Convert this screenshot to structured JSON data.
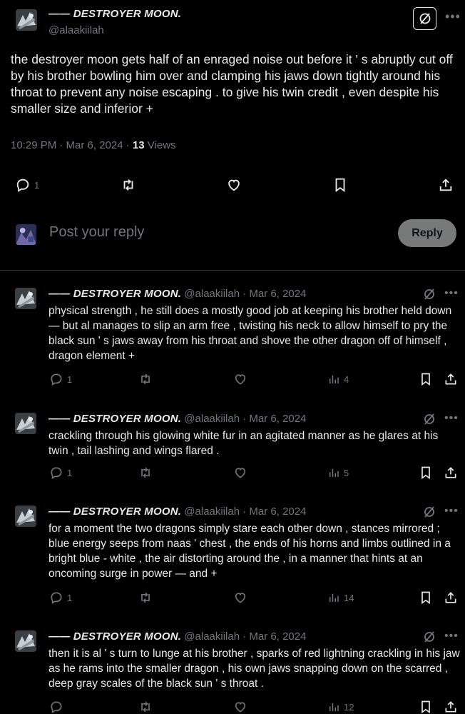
{
  "main_tweet": {
    "display_name": "—— DESTROYER MOON.",
    "handle": "@alaakiilah",
    "text": "the destroyer moon gets half of an enraged noise out before it ' s abruptly cut off by his brother bowling him over and clamping his jaws down tightly around his throat to prevent any noise escaping . to give his twin credit , even despite his smaller size and inferior +",
    "time": "10:29 PM · Mar 6, 2024 ·",
    "views_count": "13",
    "views_label": "Views",
    "reply_count": "1"
  },
  "reply_box": {
    "placeholder": "Post your reply",
    "button_label": "Reply"
  },
  "thread": [
    {
      "display_name": "—— DESTROYER MOON.",
      "handle_date": "@alaakiilah · Mar 6, 2024",
      "text": "physical strength , he still does a mostly good job at keeping his brother held down — but al manages to slip an arm free , twisting his neck to allow himself to pry the black sun ' s jaws away from his throat and shove the other dragon off of himself , dragon element +",
      "replies": "1",
      "views": "4"
    },
    {
      "display_name": "—— DESTROYER MOON.",
      "handle_date": "@alaakiilah · Mar 6, 2024",
      "text": "crackling through his glowing white fur in an agitated manner as he glares at his twin , tail lashing and wings flared .",
      "replies": "1",
      "views": "5"
    },
    {
      "display_name": "—— DESTROYER MOON.",
      "handle_date": "@alaakiilah · Mar 6, 2024",
      "text": "for a moment the two dragons simply stare each other down , stances mirrored ; blue energy seeps from naas ' chest , the ends of his horns and limbs outlined in a bright blue - white , the air distorting around the , in a manner that hints at an oncoming surge in power — and +",
      "replies": "1",
      "views": "14"
    },
    {
      "display_name": "—— DESTROYER MOON.",
      "handle_date": "@alaakiilah · Mar 6, 2024",
      "text": "then it is al ' s turn to lunge at his brother , sparks of red lightning crackling in his jaw as he rams into the smaller dragon , his own jaws snapping down on the scarred , deep gray scales of the black sun ' s throat .",
      "replies": "",
      "views": "12"
    }
  ],
  "icons": {
    "reply": "speech-bubble-icon",
    "repost": "repost-arrows-icon",
    "like": "heart-icon",
    "bookmark": "bookmark-icon",
    "share": "upload-share-icon",
    "views": "bar-chart-icon",
    "grok": "grok-slash-icon",
    "more": "more-dots-icon"
  },
  "colors": {
    "background": "#000000",
    "text": "#e7e9ea",
    "secondary": "#71767b",
    "reply_button": "#787a7a"
  }
}
